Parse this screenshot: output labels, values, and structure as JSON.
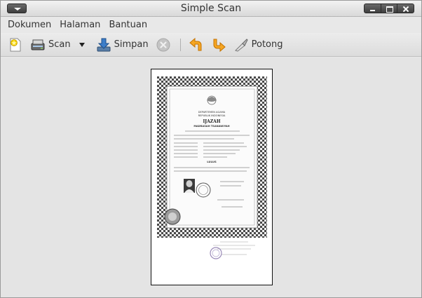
{
  "window": {
    "title": "Simple Scan"
  },
  "menu": {
    "items": [
      "Dokumen",
      "Halaman",
      "Bantuan"
    ]
  },
  "toolbar": {
    "new_icon": "new-document-icon",
    "scan_label": "Scan",
    "save_label": "Simpan",
    "crop_label": "Potong"
  },
  "document": {
    "ministry": "DEPARTEMEN AGAMA",
    "country": "REPUBLIK INDONESIA",
    "heading": "IJAZAH",
    "school_type": "MADRASAH TSANAWIYAH",
    "result": "LULUS"
  }
}
